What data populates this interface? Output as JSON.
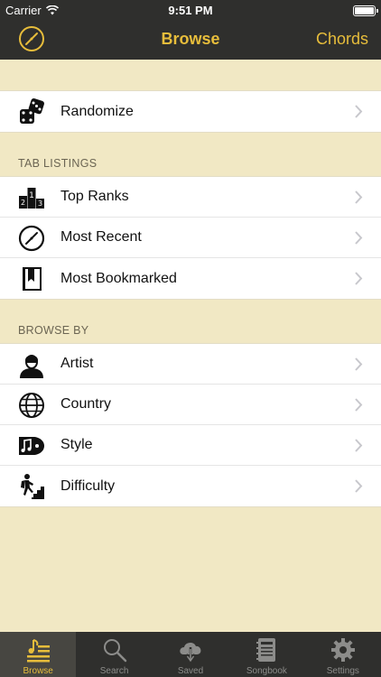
{
  "status": {
    "carrier": "Carrier",
    "time": "9:51 PM"
  },
  "nav": {
    "title": "Browse",
    "right_button": "Chords"
  },
  "randomize": {
    "label": "Randomize"
  },
  "tab_listings": {
    "header": "TAB LISTINGS",
    "items": [
      {
        "label": "Top Ranks",
        "icon": "podium-icon"
      },
      {
        "label": "Most Recent",
        "icon": "clock-icon"
      },
      {
        "label": "Most Bookmarked",
        "icon": "bookmark-book-icon"
      }
    ]
  },
  "browse_by": {
    "header": "BROWSE BY",
    "items": [
      {
        "label": "Artist",
        "icon": "person-icon"
      },
      {
        "label": "Country",
        "icon": "globe-icon"
      },
      {
        "label": "Style",
        "icon": "music-note-icon"
      },
      {
        "label": "Difficulty",
        "icon": "climber-icon"
      }
    ]
  },
  "tabs": [
    {
      "label": "Browse",
      "icon": "browse-icon",
      "active": true
    },
    {
      "label": "Search",
      "icon": "search-icon",
      "active": false
    },
    {
      "label": "Saved",
      "icon": "cloud-download-icon",
      "active": false
    },
    {
      "label": "Songbook",
      "icon": "songbook-icon",
      "active": false
    },
    {
      "label": "Settings",
      "icon": "gear-icon",
      "active": false
    }
  ],
  "colors": {
    "accent": "#e7bd3b",
    "bar": "#2f2f2d",
    "background": "#f1e8c4"
  }
}
